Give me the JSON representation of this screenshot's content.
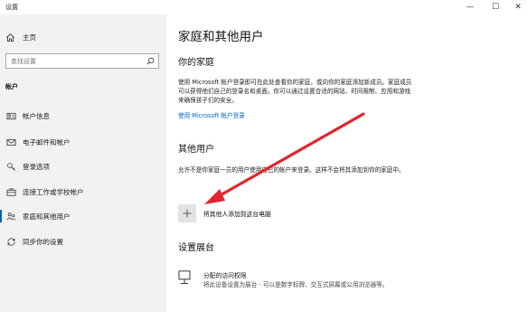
{
  "window": {
    "title": "设置",
    "minimize_glyph": "—",
    "maximize_glyph": "☐",
    "close_glyph": "✕"
  },
  "sidebar": {
    "home_label": "主页",
    "search_placeholder": "查找设置",
    "section_label": "帐户",
    "items": [
      {
        "label": "帐户信息",
        "icon": "person-card-icon"
      },
      {
        "label": "电子邮件和帐户",
        "icon": "mail-icon"
      },
      {
        "label": "登录选项",
        "icon": "key-icon"
      },
      {
        "label": "连接工作或学校帐户",
        "icon": "briefcase-icon"
      },
      {
        "label": "家庭和其他用户",
        "icon": "family-icon",
        "active": true
      },
      {
        "label": "同步你的设置",
        "icon": "sync-icon"
      }
    ]
  },
  "main": {
    "title": "家庭和其他用户",
    "family": {
      "heading": "你的家庭",
      "description": "使用 Microsoft 帐户登录即可在此处查看你的家庭，或向你的家庭添加新成员。家庭成员可以获得他们自己的登录名和桌面。你可以通过设置合适的网站、时间限制、应用和游戏来确保孩子们的安全。",
      "link": "使用 Microsoft 帐户登录"
    },
    "others": {
      "heading": "其他用户",
      "description": "允许不是你家庭一员的用户使用自己的帐户来登录。这样不会将其添加到你的家庭中。",
      "add_label": "将其他人添加到这台电脑"
    },
    "kiosk": {
      "heading": "设置展台",
      "title": "分配的访问权限",
      "description": "将此设备设置为展台 - 可以是数字标牌、交互式屏幕或公用浏览器等。"
    }
  },
  "colors": {
    "accent": "#0063b1",
    "link": "#0067c0",
    "annotation_arrow": "#e0262e",
    "sidebar_bg": "#f2f2f2"
  }
}
